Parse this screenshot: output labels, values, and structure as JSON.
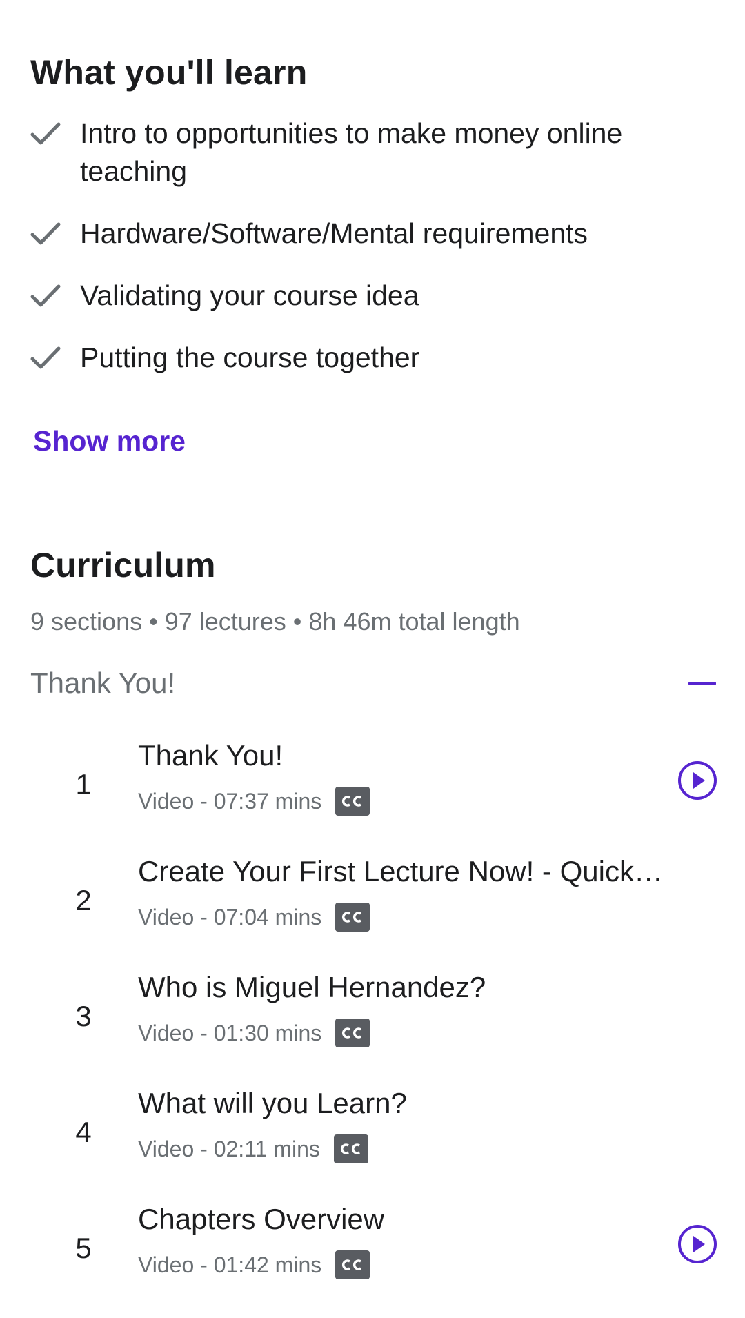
{
  "learn": {
    "title": "What you'll learn",
    "items": [
      "Intro to opportunities to make money online teaching",
      "Hardware/Software/Mental requirements",
      "Validating your course idea",
      "Putting the course together"
    ],
    "show_more": "Show more"
  },
  "curriculum": {
    "title": "Curriculum",
    "stats": "9 sections • 97 lectures • 8h 46m total length",
    "section": {
      "name": "Thank You!",
      "expanded": true,
      "lectures": [
        {
          "number": "1",
          "title": "Thank You!",
          "meta": "Video - 07:37 mins",
          "cc": true,
          "preview": true
        },
        {
          "number": "2",
          "title": "Create Your First Lecture Now! - Quick…",
          "meta": "Video - 07:04 mins",
          "cc": true,
          "preview": false
        },
        {
          "number": "3",
          "title": "Who is Miguel Hernandez?",
          "meta": "Video - 01:30 mins",
          "cc": true,
          "preview": false
        },
        {
          "number": "4",
          "title": "What will you Learn?",
          "meta": "Video - 02:11 mins",
          "cc": true,
          "preview": false
        },
        {
          "number": "5",
          "title": "Chapters Overview",
          "meta": "Video - 01:42 mins",
          "cc": true,
          "preview": true
        }
      ]
    }
  },
  "icons": {
    "check": "check-icon",
    "collapse": "minus-icon",
    "cc": "closed-captions-icon",
    "preview": "play-circle-icon"
  },
  "colors": {
    "accent": "#5624d0",
    "text": "#1c1d1f",
    "muted": "#6a6f73",
    "check": "#6a6f73",
    "cc_badge": "#595c61"
  }
}
